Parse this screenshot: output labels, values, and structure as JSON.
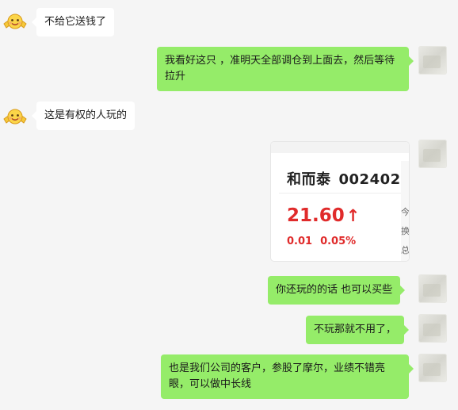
{
  "messages": [
    {
      "side": "left",
      "text": "不给它送钱了"
    },
    {
      "side": "right",
      "text": "我看好这只 ，准明天全部调仓到上面去，然后等待拉升"
    },
    {
      "side": "left",
      "text": "这是有权的人玩的"
    },
    {
      "side": "right",
      "text": "你还玩的的话 也可以买些"
    },
    {
      "side": "right",
      "text": "不玩那就不用了，"
    },
    {
      "side": "right",
      "text": "也是我们公司的客户，参股了摩尔，业绩不错亮眼，可以做中长线"
    }
  ],
  "stock_card": {
    "name": "和而泰",
    "code": "002402",
    "price": "21.60",
    "arrow": "↑",
    "change": "0.01",
    "change_pct": "0.05%",
    "side_chars": [
      "今",
      "换",
      "总"
    ]
  },
  "colors": {
    "background": "#f5f5f5",
    "incoming_bubble": "#ffffff",
    "outgoing_bubble": "#95ec69",
    "price_up": "#e02b2b"
  },
  "icons": {
    "left_avatar": "yellow-face-emoji-avatar-icon",
    "right_avatar": "blurred-user-avatar-icon"
  }
}
